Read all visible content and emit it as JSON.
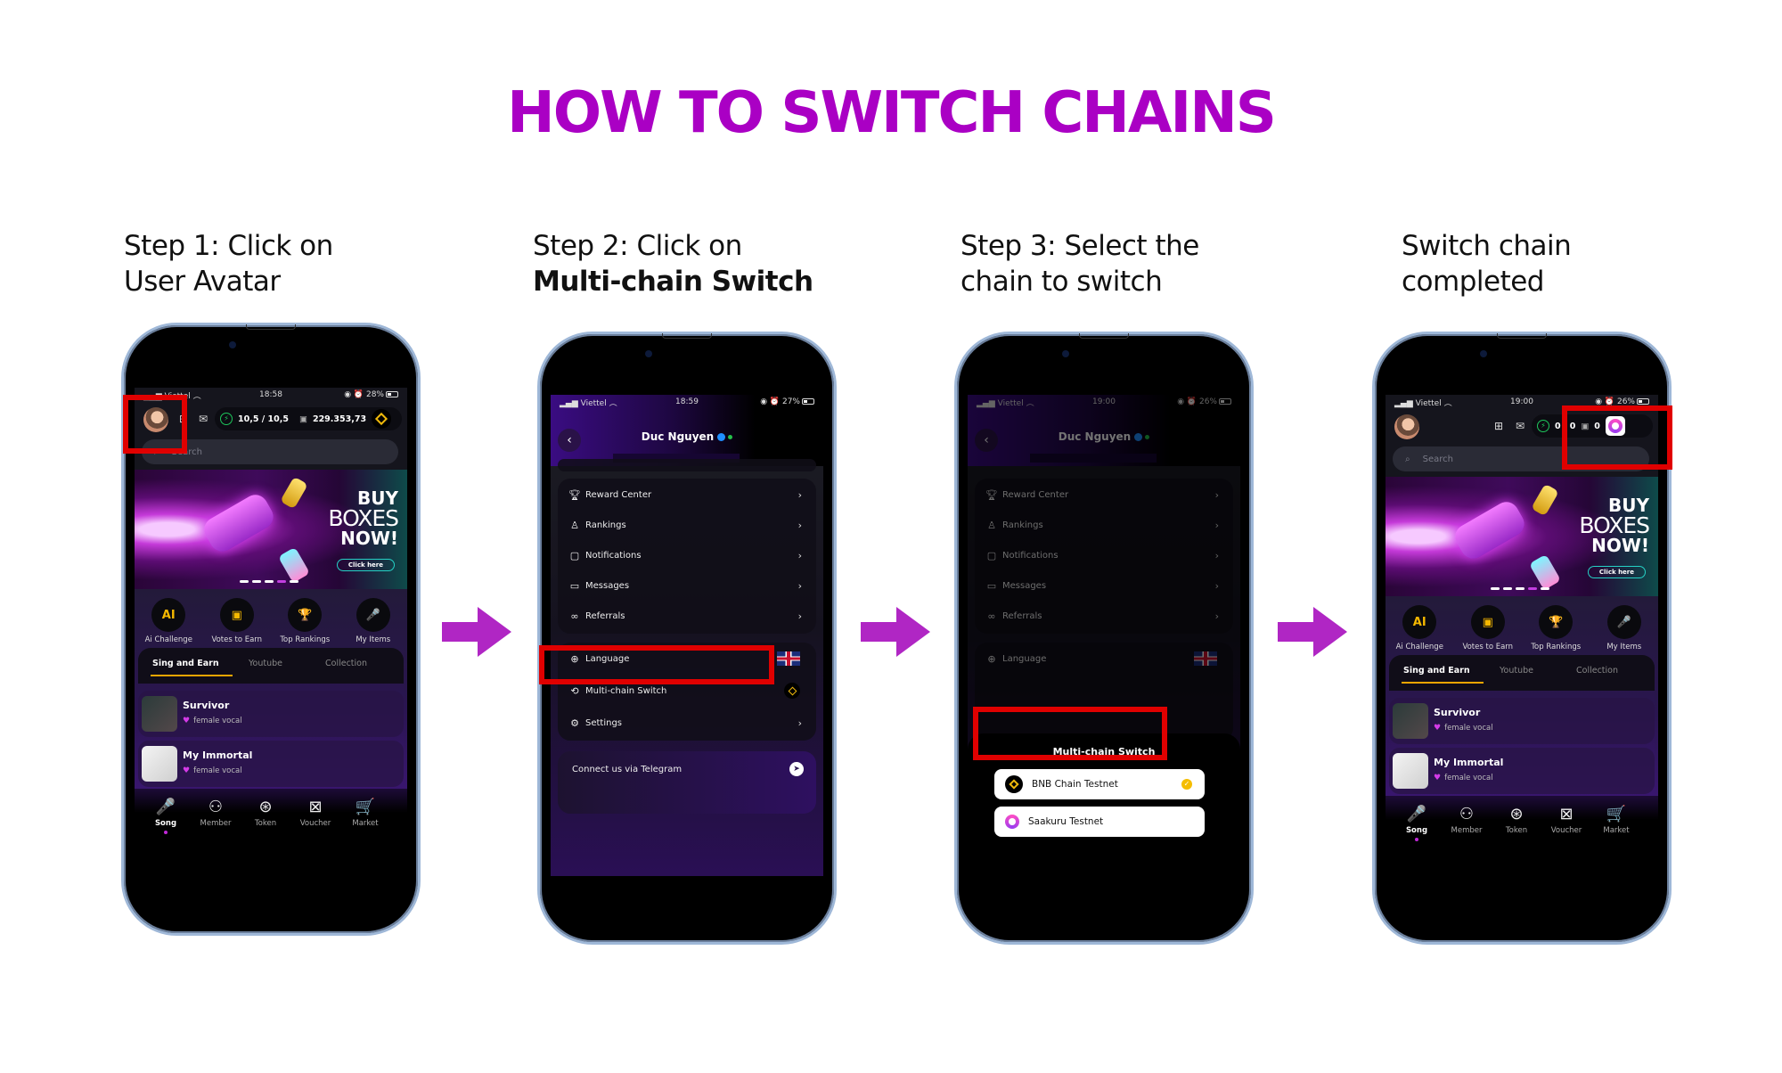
{
  "title": "HOW TO SWITCH CHAINS",
  "steps": [
    {
      "line1": "Step 1: Click on",
      "line2": "User Avatar",
      "line2_bold": false
    },
    {
      "line1": "Step 2: Click on",
      "line2": "Multi-chain Switch",
      "line2_bold": true
    },
    {
      "line1": "Step 3: Select the",
      "line2": "chain to switch",
      "line2_bold": false
    },
    {
      "line1": "Switch chain",
      "line2": "completed",
      "line2_bold": false
    }
  ],
  "colors": {
    "title": "#aa00c4",
    "arrow": "#b026c4",
    "highlight": "#e00000"
  },
  "phone1": {
    "status": {
      "carrier": "Viettel",
      "time": "18:58",
      "battery": "28%"
    },
    "energy": "10,5 / 10,5",
    "balance": "229.353,73",
    "chain_icon": "bnb-coin-icon",
    "search_placeholder": "Search",
    "banner": {
      "line1": "BUY",
      "line2": "BOXES",
      "line3": "NOW!",
      "cta": "Click here"
    },
    "quick_actions": [
      {
        "icon": "AI",
        "label": "Ai Challenge"
      },
      {
        "icon": "▣",
        "label": "Votes to Earn"
      },
      {
        "icon": "🏆",
        "label": "Top Rankings"
      },
      {
        "icon": "🎤",
        "label": "My Items"
      }
    ],
    "tabs": [
      "Sing and Earn",
      "Youtube",
      "Collection"
    ],
    "songs": [
      {
        "title": "Survivor",
        "tag": "female vocal"
      },
      {
        "title": "My Immortal",
        "tag": "female vocal"
      }
    ],
    "nav": [
      "Song",
      "Member",
      "Token",
      "Voucher",
      "Market"
    ]
  },
  "phone2": {
    "status": {
      "carrier": "Viettel",
      "time": "18:59",
      "battery": "27%"
    },
    "user_name": "Duc Nguyen",
    "menu_group1": [
      "Reward Center",
      "Rankings",
      "Notifications",
      "Messages",
      "Referrals"
    ],
    "language_label": "Language",
    "multichain_label": "Multi-chain Switch",
    "settings_label": "Settings",
    "telegram_label": "Connect us via Telegram"
  },
  "phone3": {
    "status": {
      "carrier": "Viettel",
      "time": "19:00",
      "battery": "26%"
    },
    "user_name": "Duc Nguyen",
    "menu_group1": [
      "Reward Center",
      "Rankings",
      "Notifications",
      "Messages",
      "Referrals"
    ],
    "language_label": "Language",
    "sheet_title": "Multi-chain Switch",
    "options": [
      {
        "label": "BNB Chain Testnet",
        "selected": true
      },
      {
        "label": "Saakuru Testnet",
        "selected": false
      }
    ]
  },
  "phone4": {
    "status": {
      "carrier": "Viettel",
      "time": "19:00",
      "battery": "26%"
    },
    "energy": "0 / 0",
    "balance": "0",
    "chain_icon": "saakuru-coin-icon",
    "search_placeholder": "Search"
  }
}
